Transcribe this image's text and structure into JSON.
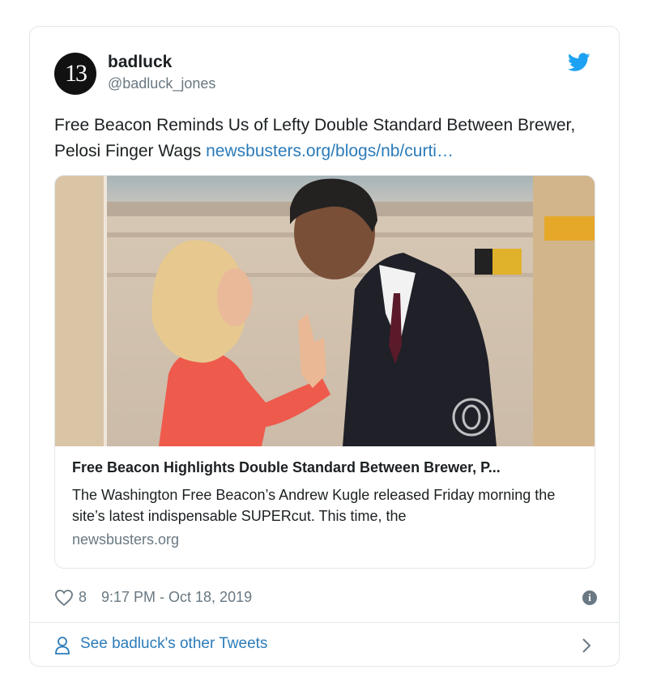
{
  "user": {
    "avatar_text": "13",
    "name": "badluck",
    "handle": "@badluck_jones"
  },
  "icons": {
    "brand": "twitter-bird-icon",
    "like": "heart-icon",
    "info": "info-icon",
    "profile": "person-icon",
    "chevron": "chevron-right-icon"
  },
  "tweet": {
    "text": "Free Beacon Reminds Us of Lefty Double Standard Between Brewer, Pelosi Finger Wags ",
    "link": "newsbusters.org/blogs/nb/curti…"
  },
  "link_card": {
    "image_watermark": "CBS",
    "title": "Free Beacon Highlights Double Standard Between Brewer, P...",
    "description": "The Washington Free Beacon’s Andrew Kugle released Friday morning the site’s latest indispensable SUPERcut. This time, the",
    "domain": "newsbusters.org"
  },
  "meta": {
    "likes": "8",
    "timestamp": "9:17 PM - Oct 18, 2019",
    "info_glyph": "i"
  },
  "footer": {
    "label": "See badluck's other Tweets"
  },
  "colors": {
    "link": "#2b7bb9",
    "brand": "#1da1f2",
    "muted": "#697882",
    "border": "#e1e8ed"
  }
}
